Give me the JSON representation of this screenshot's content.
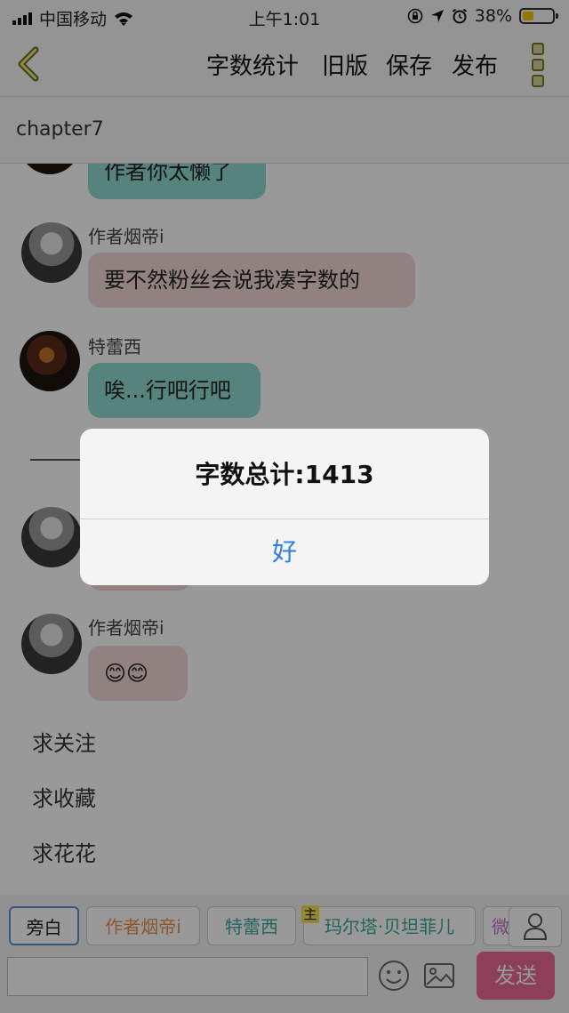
{
  "status_bar": {
    "carrier": "中国移动",
    "time": "上午1:01",
    "battery_percent": "38%",
    "battery_level": 0.38
  },
  "nav": {
    "buttons": [
      "字数统计",
      "旧版",
      "保存",
      "发布"
    ]
  },
  "chapter": {
    "title": "chapter7"
  },
  "messages": [
    {
      "speaker": "",
      "text": "作者你太懒了",
      "style": "teal"
    },
    {
      "speaker": "作者烟帝i",
      "text": "要不然粉丝会说我凑字数的",
      "style": "pink"
    },
    {
      "speaker": "特蕾西",
      "text": "唉...行吧行吧",
      "style": "teal"
    },
    {
      "speaker": "作者烟帝i",
      "text": "😊😊",
      "style": "pink"
    }
  ],
  "narration": [
    "求关注",
    "求收藏",
    "求花花"
  ],
  "roles": [
    "旁白",
    "作者烟帝i",
    "特蕾西",
    "玛尔塔·贝坦菲儿",
    "微"
  ],
  "main_tag": "主",
  "send_label": "发送",
  "alert": {
    "message": "字数总计:1413",
    "ok_label": "好"
  },
  "colors": {
    "teal_bubble": "#8fdcd0",
    "pink_bubble": "#f4d8d8",
    "send_button": "#ec6a96",
    "alert_button": "#2d7fe0"
  }
}
